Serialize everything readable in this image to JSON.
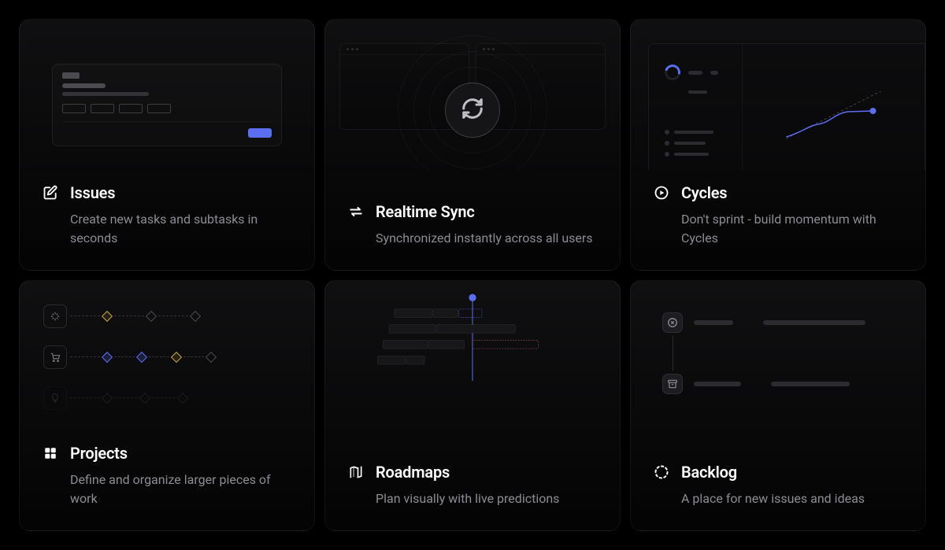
{
  "cards": [
    {
      "icon": "edit-square-icon",
      "title": "Issues",
      "description": "Create new tasks and subtasks in seconds"
    },
    {
      "icon": "sync-arrows-icon",
      "title": "Realtime Sync",
      "description": "Synchronized instantly across all users"
    },
    {
      "icon": "play-circle-icon",
      "title": "Cycles",
      "description": "Don't sprint - build momentum with Cycles"
    },
    {
      "icon": "grid-icon",
      "title": "Projects",
      "description": "Define and organize larger pieces of work"
    },
    {
      "icon": "map-icon",
      "title": "Roadmaps",
      "description": "Plan visually with live predictions"
    },
    {
      "icon": "dashed-circle-icon",
      "title": "Backlog",
      "description": "A place for new issues and ideas"
    }
  ],
  "colors": {
    "accent": "#5c6ef0",
    "text_muted": "#8c8c93",
    "amber": "#c9a24a"
  }
}
